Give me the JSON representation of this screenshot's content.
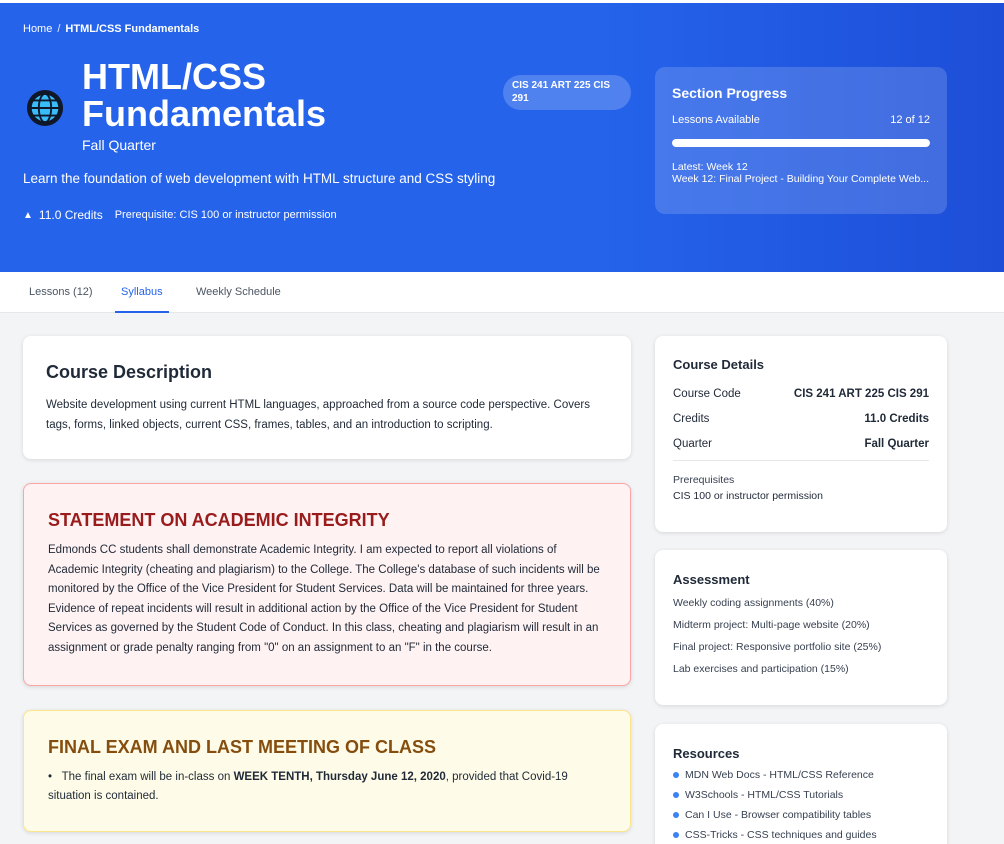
{
  "breadcrumb": {
    "home": "Home",
    "separator": "/",
    "current": "HTML/CSS Fundamentals"
  },
  "hero": {
    "title": "HTML/CSS Fundamentals",
    "quarter": "Fall Quarter",
    "course_codes": "CIS 241 ART 225 CIS 291",
    "description": "Learn the foundation of web development with HTML structure and CSS styling",
    "credits": "11.0 Credits",
    "prerequisite": "Prerequisite: CIS 100 or instructor permission",
    "icon": "globe-icon"
  },
  "progress": {
    "title": "Section Progress",
    "label": "Lessons Available",
    "count": "12 of 12",
    "fraction": 1.0,
    "latest_label": "Latest: Week 12",
    "latest_desc": "Week 12: Final Project - Building Your Complete Web..."
  },
  "tabs": [
    {
      "label": "Lessons (12)"
    },
    {
      "label": "Syllabus",
      "active": true
    },
    {
      "label": "Weekly Schedule"
    }
  ],
  "description_card": {
    "title": "Course Description",
    "body": "Website development using current HTML languages, approached from a source code perspective. Covers tags, forms, linked objects, current CSS, frames, tables, and an introduction to scripting."
  },
  "integrity_card": {
    "title": "STATEMENT ON ACADEMIC INTEGRITY",
    "body": "Edmonds CC students shall demonstrate Academic Integrity. I am expected to report all violations of Academic Integrity (cheating and plagiarism) to the College. The College's database of such incidents will be monitored by the Office of the Vice President for Student Services. Data will be maintained for three years. Evidence of repeat incidents will result in additional action by the Office of the Vice President for Student Services as governed by the Student Code of Conduct. In this class, cheating and plagiarism will result in an assignment or grade penalty ranging from \"0\" on an assignment to an \"F\" in the course."
  },
  "final_exam_card": {
    "title": "FINAL EXAM AND LAST MEETING OF CLASS",
    "bullet_prefix": "The final exam will be in-class on ",
    "bullet_bold": "WEEK TENTH, Thursday June 12, 2020",
    "bullet_suffix": ", provided that Covid-19 situation is contained."
  },
  "details": {
    "title": "Course Details",
    "rows": [
      {
        "label": "Course Code",
        "value": "CIS 241 ART 225 CIS 291"
      },
      {
        "label": "Credits",
        "value": "11.0 Credits"
      },
      {
        "label": "Quarter",
        "value": "Fall Quarter"
      }
    ],
    "prereq_label": "Prerequisites",
    "prereq_value": "CIS 100 or instructor permission"
  },
  "assessment": {
    "title": "Assessment",
    "items": [
      "Weekly coding assignments (40%)",
      "Midterm project: Multi-page website (20%)",
      "Final project: Responsive portfolio site (25%)",
      "Lab exercises and participation (15%)"
    ]
  },
  "resources": {
    "title": "Resources",
    "items": [
      "MDN Web Docs - HTML/CSS Reference",
      "W3Schools - HTML/CSS Tutorials",
      "Can I Use - Browser compatibility tables",
      "CSS-Tricks - CSS techniques and guides"
    ]
  },
  "colors": {
    "hero": "#2563eb",
    "accent": "#2563eb",
    "integrity_title": "#991b1b",
    "exam_title": "#854d0e",
    "resource_dot": "#3b82f6"
  }
}
